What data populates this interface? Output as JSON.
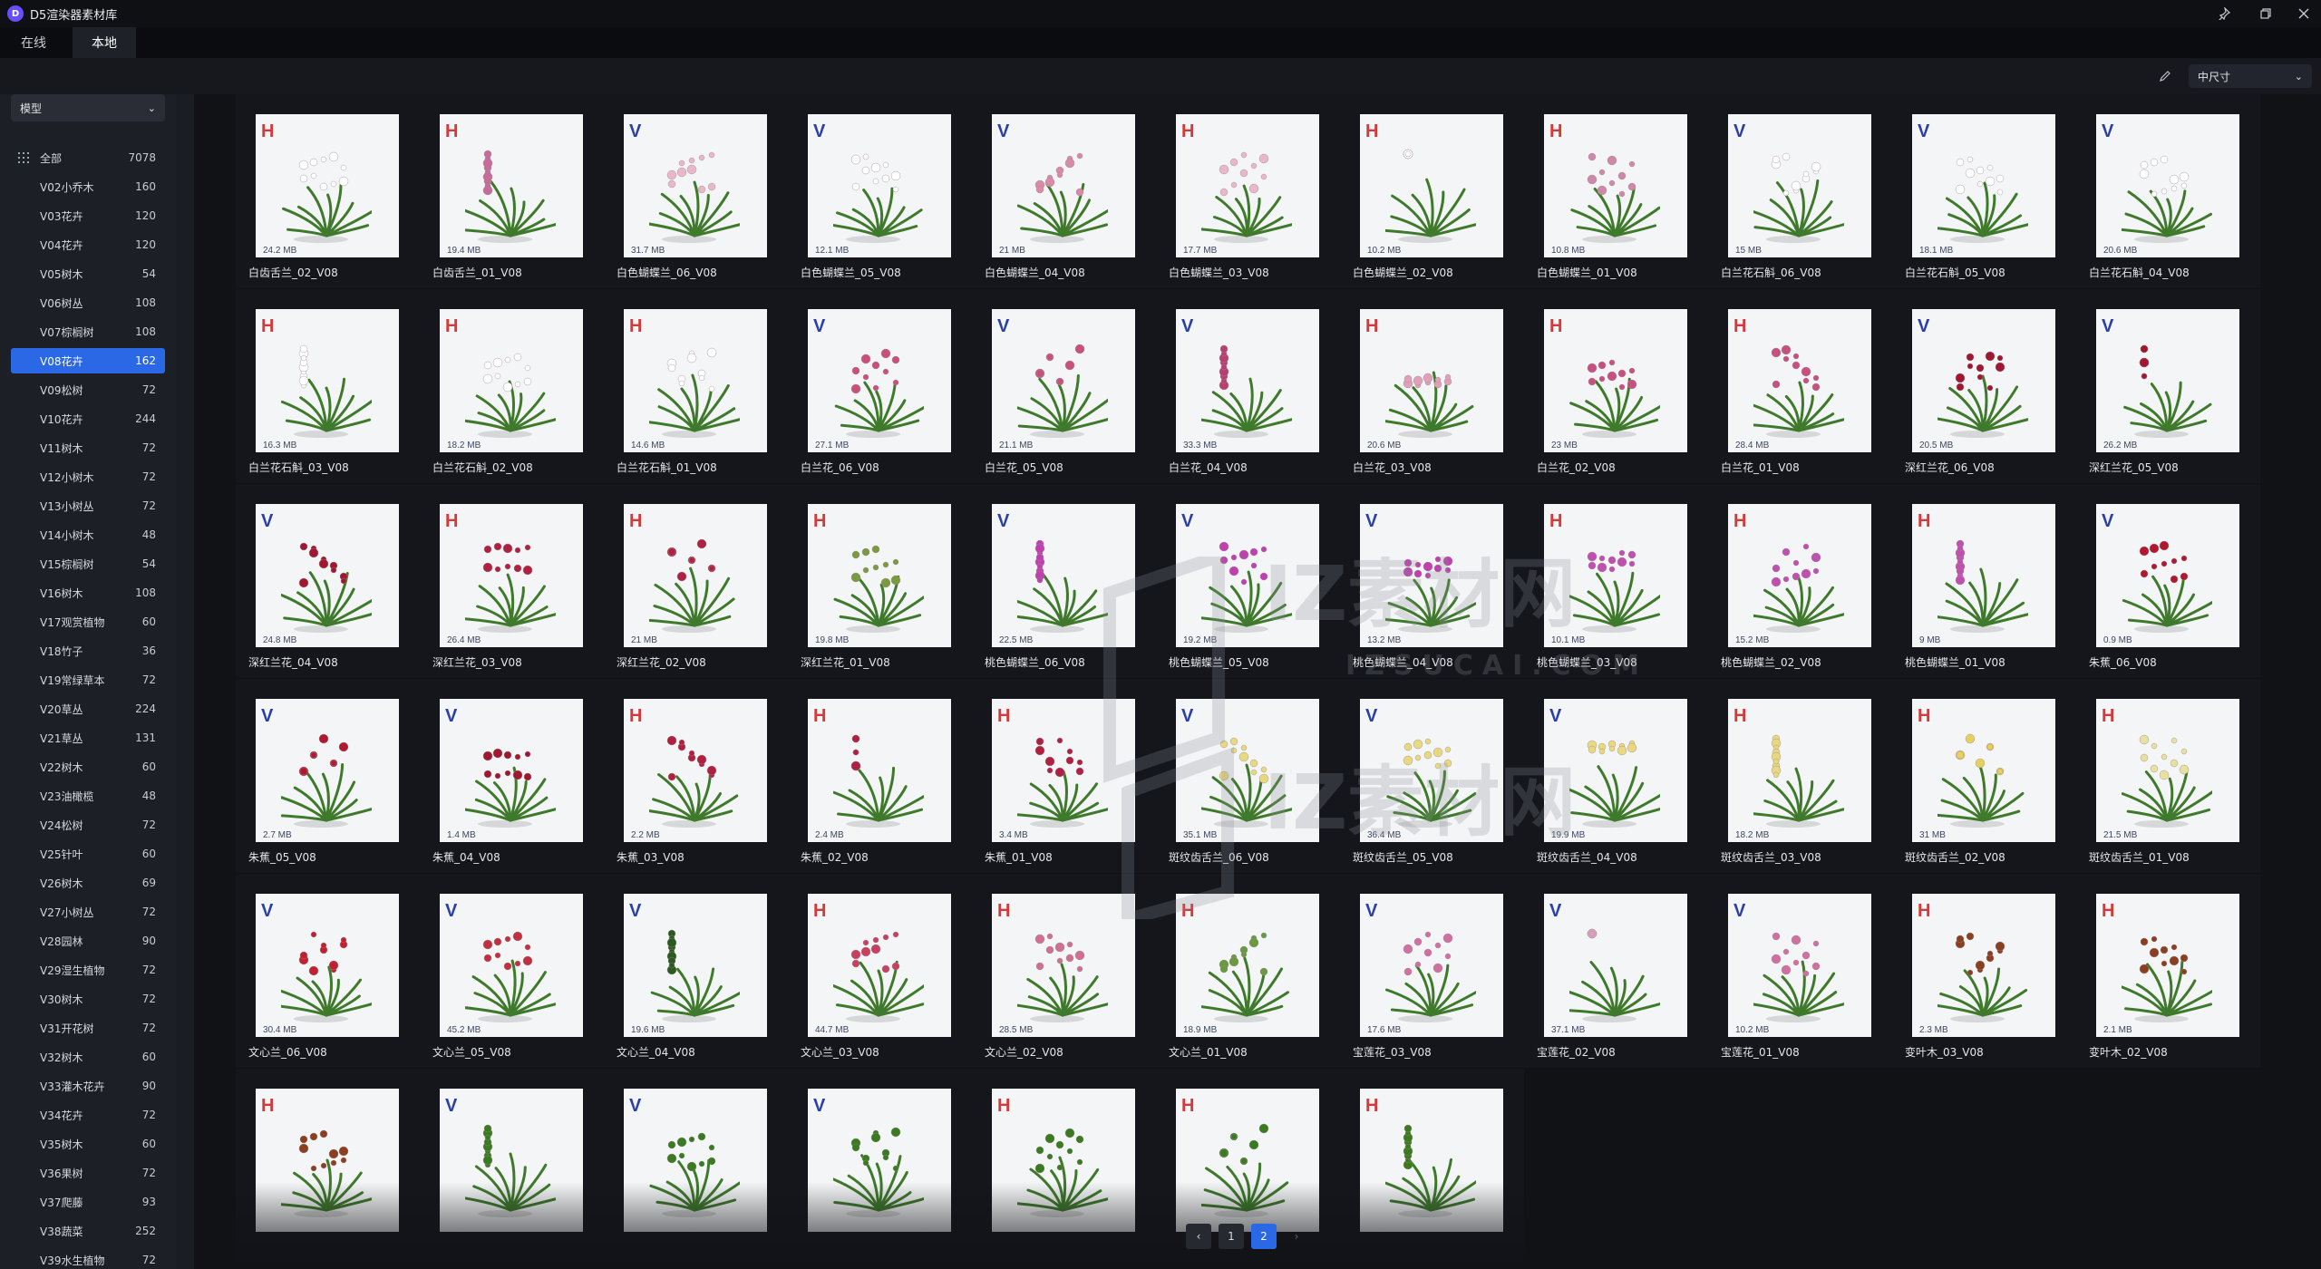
{
  "app": {
    "title": "D5渲染器素材库",
    "logo_letter": "D"
  },
  "window_controls": {
    "pin_icon": "pin-icon",
    "restore_icon": "restore-icon",
    "close_icon": "close-icon"
  },
  "tabs": [
    {
      "label": "在线",
      "active": false
    },
    {
      "label": "本地",
      "active": true
    }
  ],
  "toolbar": {
    "size_value": "中尺寸",
    "edit_icon": "pencil-icon"
  },
  "sidebar": {
    "type_value": "模型",
    "categories": [
      {
        "label": "全部",
        "count": "7078"
      },
      {
        "label": "V02小乔木",
        "count": "160"
      },
      {
        "label": "V03花卉",
        "count": "120"
      },
      {
        "label": "V04花卉",
        "count": "120"
      },
      {
        "label": "V05树木",
        "count": "54"
      },
      {
        "label": "V06树丛",
        "count": "108"
      },
      {
        "label": "V07棕榈树",
        "count": "108"
      },
      {
        "label": "V08花卉",
        "count": "162",
        "selected": true
      },
      {
        "label": "V09松树",
        "count": "72"
      },
      {
        "label": "V10花卉",
        "count": "244"
      },
      {
        "label": "V11树木",
        "count": "72"
      },
      {
        "label": "V12小树木",
        "count": "72"
      },
      {
        "label": "V13小树丛",
        "count": "72"
      },
      {
        "label": "V14小树木",
        "count": "48"
      },
      {
        "label": "V15棕榈树",
        "count": "54"
      },
      {
        "label": "V16树木",
        "count": "108"
      },
      {
        "label": "V17观赏植物",
        "count": "60"
      },
      {
        "label": "V18竹子",
        "count": "36"
      },
      {
        "label": "V19常绿草本",
        "count": "72"
      },
      {
        "label": "V20草丛",
        "count": "224"
      },
      {
        "label": "V21草丛",
        "count": "131"
      },
      {
        "label": "V22树木",
        "count": "60"
      },
      {
        "label": "V23油橄榄",
        "count": "48"
      },
      {
        "label": "V24松树",
        "count": "72"
      },
      {
        "label": "V25针叶",
        "count": "60"
      },
      {
        "label": "V26树木",
        "count": "69"
      },
      {
        "label": "V27小树丛",
        "count": "72"
      },
      {
        "label": "V28园林",
        "count": "90"
      },
      {
        "label": "V29湿生植物",
        "count": "72"
      },
      {
        "label": "V30树木",
        "count": "72"
      },
      {
        "label": "V31开花树",
        "count": "72"
      },
      {
        "label": "V32树木",
        "count": "60"
      },
      {
        "label": "V33灌木花卉",
        "count": "90"
      },
      {
        "label": "V34花卉",
        "count": "72"
      },
      {
        "label": "V35树木",
        "count": "60"
      },
      {
        "label": "V36果树",
        "count": "72"
      },
      {
        "label": "V37爬藤",
        "count": "93"
      },
      {
        "label": "V38蔬菜",
        "count": "252"
      },
      {
        "label": "V39水生植物",
        "count": "72"
      }
    ]
  },
  "assets": [
    {
      "name": "白齿舌兰_02_V08",
      "tag": "H",
      "size": "24.2 MB",
      "flower": "#ffffff"
    },
    {
      "name": "白齿舌兰_01_V08",
      "tag": "H",
      "size": "19.4 MB",
      "flower": "#c86a9a"
    },
    {
      "name": "白色蝴蝶兰_06_V08",
      "tag": "V",
      "size": "31.7 MB",
      "flower": "#e8b8c8"
    },
    {
      "name": "白色蝴蝶兰_05_V08",
      "tag": "V",
      "size": "12.1 MB",
      "flower": "#ffffff"
    },
    {
      "name": "白色蝴蝶兰_04_V08",
      "tag": "V",
      "size": "21 MB",
      "flower": "#d88aa8"
    },
    {
      "name": "白色蝴蝶兰_03_V08",
      "tag": "H",
      "size": "17.7 MB",
      "flower": "#e8b8c8"
    },
    {
      "name": "白色蝴蝶兰_02_V08",
      "tag": "H",
      "size": "10.2 MB",
      "flower": "#ffffff"
    },
    {
      "name": "白色蝴蝶兰_01_V08",
      "tag": "H",
      "size": "10.8 MB",
      "flower": "#d088a8"
    },
    {
      "name": "白兰花石斛_06_V08",
      "tag": "V",
      "size": "15 MB",
      "flower": "#ffffff"
    },
    {
      "name": "白兰花石斛_05_V08",
      "tag": "V",
      "size": "18.1 MB",
      "flower": "#ffffff"
    },
    {
      "name": "白兰花石斛_04_V08",
      "tag": "V",
      "size": "20.6 MB",
      "flower": "#ffffff"
    },
    {
      "name": "白兰花石斛_03_V08",
      "tag": "H",
      "size": "16.3 MB",
      "flower": "#ffffff"
    },
    {
      "name": "白兰花石斛_02_V08",
      "tag": "H",
      "size": "18.2 MB",
      "flower": "#ffffff"
    },
    {
      "name": "白兰花石斛_01_V08",
      "tag": "H",
      "size": "14.6 MB",
      "flower": "#ffffff"
    },
    {
      "name": "白兰花_06_V08",
      "tag": "V",
      "size": "27.1 MB",
      "flower": "#c8507a"
    },
    {
      "name": "白兰花_05_V08",
      "tag": "V",
      "size": "21.1 MB",
      "flower": "#c8507a"
    },
    {
      "name": "白兰花_04_V08",
      "tag": "V",
      "size": "33.3 MB",
      "flower": "#b84070"
    },
    {
      "name": "白兰花_03_V08",
      "tag": "H",
      "size": "20.6 MB",
      "flower": "#e0a0b8"
    },
    {
      "name": "白兰花_02_V08",
      "tag": "H",
      "size": "23 MB",
      "flower": "#c85080"
    },
    {
      "name": "白兰花_01_V08",
      "tag": "H",
      "size": "28.4 MB",
      "flower": "#c85080"
    },
    {
      "name": "深红兰花_06_V08",
      "tag": "V",
      "size": "20.5 MB",
      "flower": "#a01830"
    },
    {
      "name": "深红兰花_05_V08",
      "tag": "V",
      "size": "26.2 MB",
      "flower": "#a01830"
    },
    {
      "name": "深红兰花_04_V08",
      "tag": "V",
      "size": "24.8 MB",
      "flower": "#a01830"
    },
    {
      "name": "深红兰花_03_V08",
      "tag": "H",
      "size": "26.4 MB",
      "flower": "#b02040"
    },
    {
      "name": "深红兰花_02_V08",
      "tag": "H",
      "size": "21 MB",
      "flower": "#b02040"
    },
    {
      "name": "深红兰花_01_V08",
      "tag": "H",
      "size": "19.8 MB",
      "flower": "#7a9a40"
    },
    {
      "name": "桃色蝴蝶兰_06_V08",
      "tag": "V",
      "size": "22.5 MB",
      "flower": "#c040b0"
    },
    {
      "name": "桃色蝴蝶兰_05_V08",
      "tag": "V",
      "size": "19.2 MB",
      "flower": "#c040b0"
    },
    {
      "name": "桃色蝴蝶兰_04_V08",
      "tag": "V",
      "size": "13.2 MB",
      "flower": "#c040b0"
    },
    {
      "name": "桃色蝴蝶兰_03_V08",
      "tag": "H",
      "size": "10.1 MB",
      "flower": "#c050b0"
    },
    {
      "name": "桃色蝴蝶兰_02_V08",
      "tag": "H",
      "size": "15.2 MB",
      "flower": "#c050b0"
    },
    {
      "name": "桃色蝴蝶兰_01_V08",
      "tag": "H",
      "size": "9 MB",
      "flower": "#c050b0"
    },
    {
      "name": "朱蕉_06_V08",
      "tag": "V",
      "size": "0.9 MB",
      "flower": "#b01830"
    },
    {
      "name": "朱蕉_05_V08",
      "tag": "V",
      "size": "2.7 MB",
      "flower": "#b01830"
    },
    {
      "name": "朱蕉_04_V08",
      "tag": "V",
      "size": "1.4 MB",
      "flower": "#a01830"
    },
    {
      "name": "朱蕉_03_V08",
      "tag": "H",
      "size": "2.2 MB",
      "flower": "#b02040"
    },
    {
      "name": "朱蕉_02_V08",
      "tag": "H",
      "size": "2.4 MB",
      "flower": "#b02040"
    },
    {
      "name": "朱蕉_01_V08",
      "tag": "H",
      "size": "3.4 MB",
      "flower": "#b02040"
    },
    {
      "name": "斑纹齿舌兰_06_V08",
      "tag": "V",
      "size": "35.1 MB",
      "flower": "#e8d880"
    },
    {
      "name": "斑纹齿舌兰_05_V08",
      "tag": "V",
      "size": "36.4 MB",
      "flower": "#e8d880"
    },
    {
      "name": "斑纹齿舌兰_04_V08",
      "tag": "V",
      "size": "19.9 MB",
      "flower": "#e8d880"
    },
    {
      "name": "斑纹齿舌兰_03_V08",
      "tag": "H",
      "size": "18.2 MB",
      "flower": "#e8d880"
    },
    {
      "name": "斑纹齿舌兰_02_V08",
      "tag": "H",
      "size": "31 MB",
      "flower": "#e8d060"
    },
    {
      "name": "斑纹齿舌兰_01_V08",
      "tag": "H",
      "size": "21.5 MB",
      "flower": "#e8e0a0"
    },
    {
      "name": "文心兰_06_V08",
      "tag": "V",
      "size": "30.4 MB",
      "flower": "#c02030"
    },
    {
      "name": "文心兰_05_V08",
      "tag": "V",
      "size": "45.2 MB",
      "flower": "#c03040"
    },
    {
      "name": "文心兰_04_V08",
      "tag": "V",
      "size": "19.6 MB",
      "flower": "#2a5a20"
    },
    {
      "name": "文心兰_03_V08",
      "tag": "H",
      "size": "44.7 MB",
      "flower": "#c84060"
    },
    {
      "name": "文心兰_02_V08",
      "tag": "H",
      "size": "28.5 MB",
      "flower": "#d07090"
    },
    {
      "name": "文心兰_01_V08",
      "tag": "H",
      "size": "18.9 MB",
      "flower": "#6a9a40"
    },
    {
      "name": "宝莲花_03_V08",
      "tag": "V",
      "size": "17.6 MB",
      "flower": "#d070a0"
    },
    {
      "name": "宝莲花_02_V08",
      "tag": "V",
      "size": "37.1 MB",
      "flower": "#e0a0c0"
    },
    {
      "name": "宝莲花_01_V08",
      "tag": "V",
      "size": "10.2 MB",
      "flower": "#d070a0"
    },
    {
      "name": "变叶木_03_V08",
      "tag": "H",
      "size": "2.3 MB",
      "flower": "#8a4020"
    },
    {
      "name": "变叶木_02_V08",
      "tag": "H",
      "size": "2.1 MB",
      "flower": "#8a4020"
    },
    {
      "name": "",
      "tag": "H",
      "size": "",
      "flower": "#8a4020"
    },
    {
      "name": "",
      "tag": "V",
      "size": "",
      "flower": "#3a7a20"
    },
    {
      "name": "",
      "tag": "V",
      "size": "",
      "flower": "#3a7a20"
    },
    {
      "name": "",
      "tag": "V",
      "size": "",
      "flower": "#3a7a20"
    },
    {
      "name": "",
      "tag": "H",
      "size": "",
      "flower": "#3a7a20"
    },
    {
      "name": "",
      "tag": "H",
      "size": "",
      "flower": "#3a7a20"
    },
    {
      "name": "",
      "tag": "H",
      "size": "",
      "flower": "#3a7a20"
    }
  ],
  "pagination": {
    "prev": "‹",
    "pages": [
      "1",
      "2"
    ],
    "current": "2",
    "next": "›"
  },
  "watermark": {
    "text1": "IZ素材网",
    "text2": "IZSUCAI.COM"
  },
  "colors": {
    "accent": "#2a68e5",
    "tag_h": "#d23b3b",
    "tag_v": "#2a3fa8"
  }
}
